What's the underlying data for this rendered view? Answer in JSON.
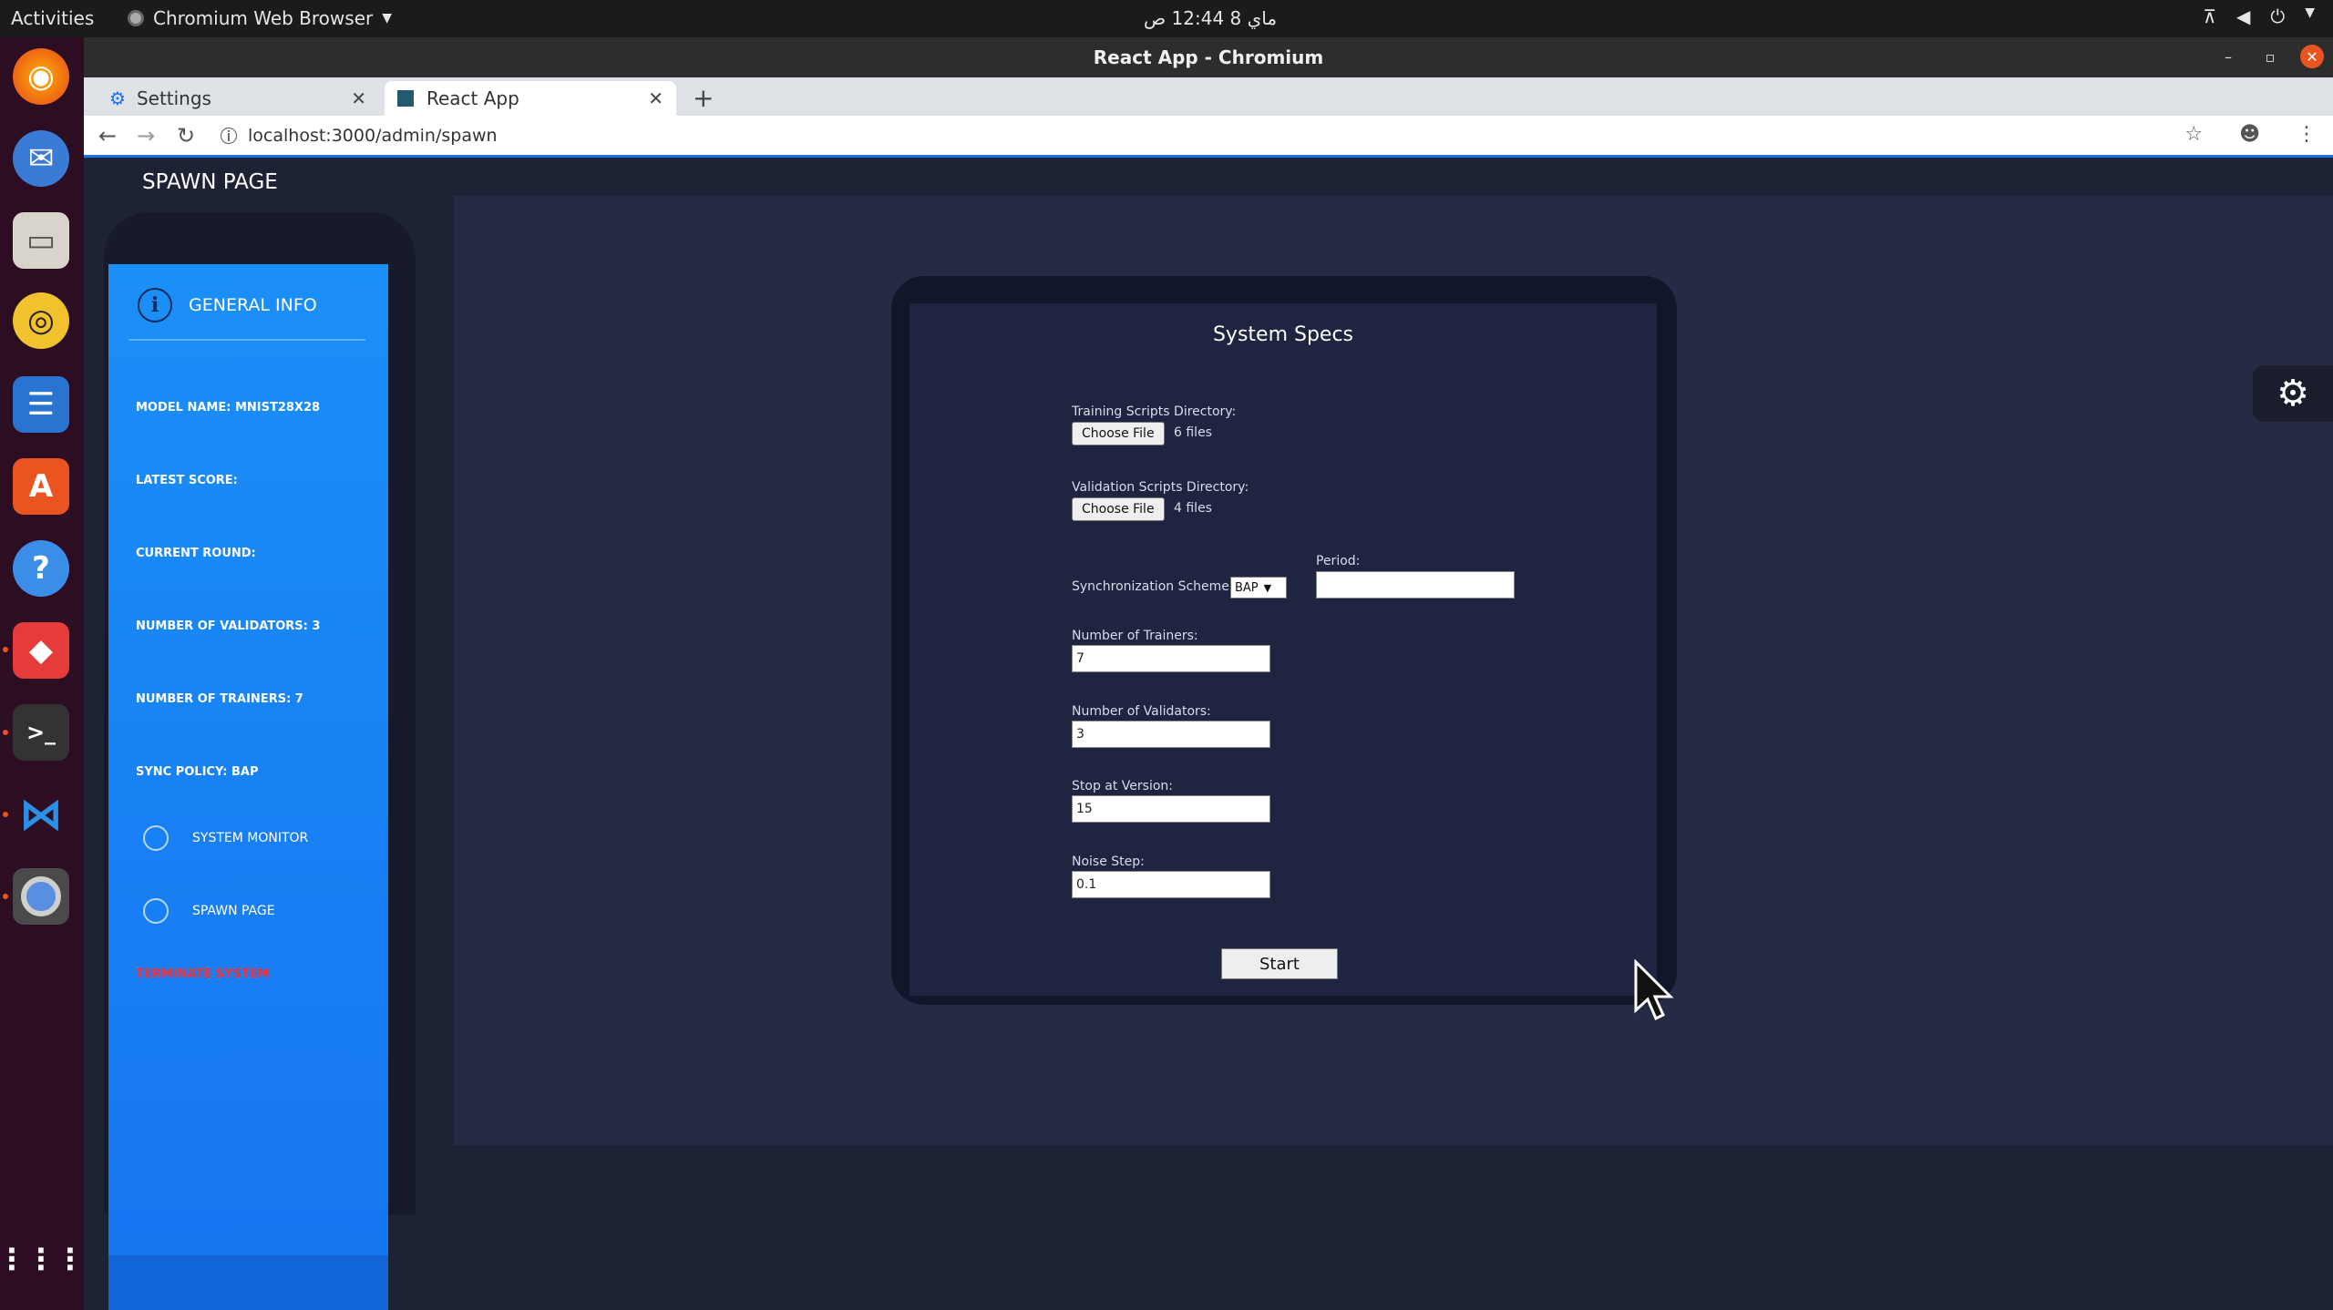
{
  "topbar": {
    "activities": "Activities",
    "app_name": "Chromium Web Browser",
    "clock": "ماي 8  12:44 ص"
  },
  "window": {
    "title": "React App - Chromium"
  },
  "tabs": [
    {
      "label": "Settings"
    },
    {
      "label": "React App"
    }
  ],
  "address_bar": {
    "url": "localhost:3000/admin/spawn"
  },
  "page": {
    "header": "SPAWN PAGE"
  },
  "sidebar": {
    "heading": "GENERAL INFO",
    "items": [
      "MODEL NAME: MNIST28X28",
      "LATEST SCORE:",
      "CURRENT ROUND:",
      "NUMBER OF VALIDATORS: 3",
      "NUMBER OF TRAINERS: 7",
      "SYNC POLICY: BAP"
    ],
    "nav": [
      "SYSTEM MONITOR",
      "SPAWN PAGE"
    ],
    "terminate": "TERMINATE SYSTEM"
  },
  "card": {
    "title": "System Specs",
    "training_label": "Training Scripts Directory:",
    "training_button": "Choose File",
    "training_files": "6 files",
    "validation_label": "Validation Scripts Directory:",
    "validation_button": "Choose File",
    "validation_files": "4 files",
    "sync_label": "Synchronization Scheme:",
    "sync_value": "BAP",
    "period_label": "Period:",
    "period_value": "",
    "trainers_label": "Number of Trainers:",
    "trainers_value": "7",
    "validators_label": "Number of Validators:",
    "validators_value": "3",
    "stop_label": "Stop at Version:",
    "stop_value": "15",
    "noise_label": "Noise Step:",
    "noise_value": "0.1",
    "start_button": "Start"
  },
  "colors": {
    "sidebar_blue": "#1b8ff8",
    "page_bg": "#1e2235",
    "card_bg": "#1f2541",
    "terminate_red": "#ff2d2d",
    "ubuntu_orange": "#e95420"
  }
}
